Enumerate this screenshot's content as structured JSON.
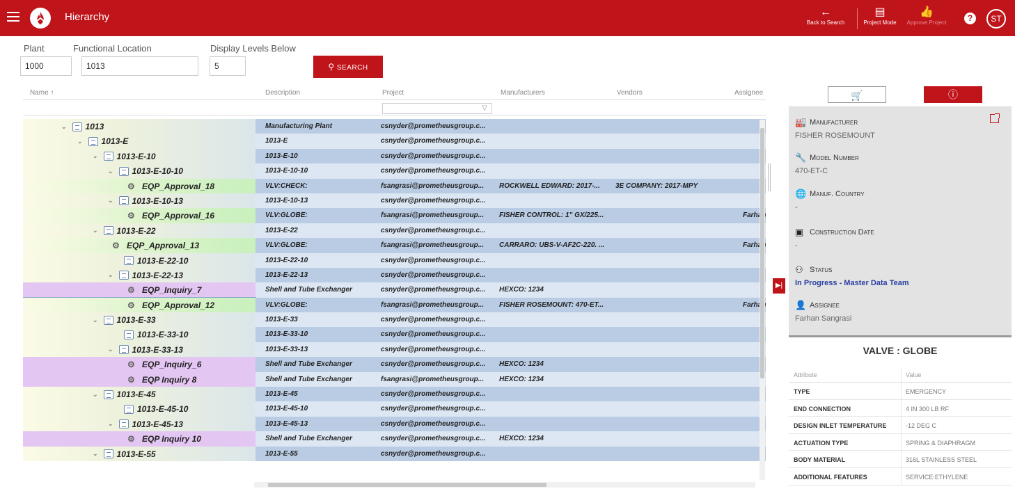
{
  "header": {
    "title": "Hierarchy",
    "back_label": "Back to Search",
    "project_mode_label": "Project Mode",
    "approve_label": "Approve Project",
    "avatar_initials": "ST",
    "accent": "#c0141b"
  },
  "filters": {
    "plant_label": "Plant",
    "plant_value": "1000",
    "floc_label": "Functional Location",
    "floc_value": "1013",
    "levels_label": "Display Levels Below",
    "levels_value": "5",
    "search_label": "SEARCH"
  },
  "grid": {
    "columns": [
      "Name ↑",
      "Description",
      "Project",
      "Manufacturers",
      "Vendors",
      "Assignee"
    ],
    "rows": [
      {
        "name": "1013",
        "type": "floc",
        "desc": "Manufacturing Plant",
        "project": "csnyder@prometheusgroup.c...",
        "mfr": "",
        "vendor": "",
        "assignee": ""
      },
      {
        "name": "1013-E",
        "type": "floc",
        "desc": "1013-E",
        "project": "csnyder@prometheusgroup.c...",
        "mfr": "",
        "vendor": "",
        "assignee": ""
      },
      {
        "name": "1013-E-10",
        "type": "floc",
        "desc": "1013-E-10",
        "project": "csnyder@prometheusgroup.c...",
        "mfr": "",
        "vendor": "",
        "assignee": ""
      },
      {
        "name": "1013-E-10-10",
        "type": "floc",
        "desc": "1013-E-10-10",
        "project": "csnyder@prometheusgroup.c...",
        "mfr": "",
        "vendor": "",
        "assignee": ""
      },
      {
        "name": "EQP_Approval_18",
        "type": "eqp",
        "desc": "VLV:CHECK:",
        "project": "fsangrasi@prometheusgroup...",
        "mfr": "ROCKWELL EDWARD: 2017-...",
        "vendor": "3E COMPANY: 2017-MPY",
        "assignee": ""
      },
      {
        "name": "1013-E-10-13",
        "type": "floc",
        "desc": "1013-E-10-13",
        "project": "csnyder@prometheusgroup.c...",
        "mfr": "",
        "vendor": "",
        "assignee": ""
      },
      {
        "name": "EQP_Approval_16",
        "type": "eqp",
        "desc": "VLV:GLOBE:",
        "project": "fsangrasi@prometheusgroup...",
        "mfr": "FISHER CONTROL: 1\" GX/225...",
        "vendor": "",
        "assignee": "Farhan"
      },
      {
        "name": "1013-E-22",
        "type": "floc",
        "desc": "1013-E-22",
        "project": "csnyder@prometheusgroup.c...",
        "mfr": "",
        "vendor": "",
        "assignee": ""
      },
      {
        "name": "EQP_Approval_13",
        "type": "eqp",
        "desc": "VLV:GLOBE:",
        "project": "fsangrasi@prometheusgroup...",
        "mfr": "CARRARO: UBS-V-AF2C-220. ...",
        "vendor": "",
        "assignee": "Farhan"
      },
      {
        "name": "1013-E-22-10",
        "type": "floc",
        "desc": "1013-E-22-10",
        "project": "csnyder@prometheusgroup.c...",
        "mfr": "",
        "vendor": "",
        "assignee": ""
      },
      {
        "name": "1013-E-22-13",
        "type": "floc",
        "desc": "1013-E-22-13",
        "project": "csnyder@prometheusgroup.c...",
        "mfr": "",
        "vendor": "",
        "assignee": ""
      },
      {
        "name": "EQP_Inquiry_7",
        "type": "eqp",
        "desc": "Shell and Tube Exchanger",
        "project": "csnyder@prometheusgroup.c...",
        "mfr": "HEXCO: 1234",
        "vendor": "",
        "assignee": ""
      },
      {
        "name": "EQP_Approval_12",
        "type": "eqp",
        "desc": "VLV:GLOBE:",
        "project": "fsangrasi@prometheusgroup...",
        "mfr": "FISHER ROSEMOUNT: 470-ET...",
        "vendor": "",
        "assignee": "Farhan"
      },
      {
        "name": "1013-E-33",
        "type": "floc",
        "desc": "1013-E-33",
        "project": "csnyder@prometheusgroup.c...",
        "mfr": "",
        "vendor": "",
        "assignee": ""
      },
      {
        "name": "1013-E-33-10",
        "type": "floc",
        "desc": "1013-E-33-10",
        "project": "csnyder@prometheusgroup.c...",
        "mfr": "",
        "vendor": "",
        "assignee": ""
      },
      {
        "name": "1013-E-33-13",
        "type": "floc",
        "desc": "1013-E-33-13",
        "project": "csnyder@prometheusgroup.c...",
        "mfr": "",
        "vendor": "",
        "assignee": ""
      },
      {
        "name": "EQP_Inquiry_6",
        "type": "eqp",
        "desc": "Shell and Tube Exchanger",
        "project": "csnyder@prometheusgroup.c...",
        "mfr": "HEXCO: 1234",
        "vendor": "",
        "assignee": ""
      },
      {
        "name": "EQP Inquiry 8",
        "type": "eqp",
        "desc": "Shell and Tube Exchanger",
        "project": "fsangrasi@prometheusgroup...",
        "mfr": "HEXCO: 1234",
        "vendor": "",
        "assignee": ""
      },
      {
        "name": "1013-E-45",
        "type": "floc",
        "desc": "1013-E-45",
        "project": "csnyder@prometheusgroup.c...",
        "mfr": "",
        "vendor": "",
        "assignee": ""
      },
      {
        "name": "1013-E-45-10",
        "type": "floc",
        "desc": "1013-E-45-10",
        "project": "csnyder@prometheusgroup.c...",
        "mfr": "",
        "vendor": "",
        "assignee": ""
      },
      {
        "name": "1013-E-45-13",
        "type": "floc",
        "desc": "1013-E-45-13",
        "project": "csnyder@prometheusgroup.c...",
        "mfr": "",
        "vendor": "",
        "assignee": ""
      },
      {
        "name": "EQP Inquiry 10",
        "type": "eqp",
        "desc": "Shell and Tube Exchanger",
        "project": "csnyder@prometheusgroup.c...",
        "mfr": "HEXCO: 1234",
        "vendor": "",
        "assignee": ""
      },
      {
        "name": "1013-E-55",
        "type": "floc",
        "desc": "1013-E-55",
        "project": "csnyder@prometheusgroup.c...",
        "mfr": "",
        "vendor": "",
        "assignee": ""
      }
    ]
  },
  "details": {
    "manufacturer_label": "Manufacturer",
    "manufacturer_value": "FISHER ROSEMOUNT",
    "model_label": "Model Number",
    "model_value": "470-ET-C",
    "country_label": "Manuf. Country",
    "country_value": "-",
    "construction_label": "Construction Date",
    "construction_value": "-",
    "status_label": "Status",
    "status_value": "In Progress - Master Data Team",
    "assignee_label": "Assignee",
    "assignee_value": "Farhan Sangrasi"
  },
  "attributes": {
    "title": "VALVE : GLOBE",
    "col_attribute": "Attribute",
    "col_value": "Value",
    "rows": [
      {
        "k": "TYPE",
        "v": "EMERGENCY"
      },
      {
        "k": "END CONNECTION",
        "v": "4 IN 300 LB RF"
      },
      {
        "k": "DESIGN INLET TEMPERATURE",
        "v": "-12 DEG C"
      },
      {
        "k": "ACTUATION TYPE",
        "v": "SPRING & DIAPHRAGM"
      },
      {
        "k": "BODY MATERIAL",
        "v": "316L STAINLESS STEEL"
      },
      {
        "k": "ADDITIONAL FEATURES",
        "v": "SERVICE:ETHYLENE"
      }
    ]
  }
}
